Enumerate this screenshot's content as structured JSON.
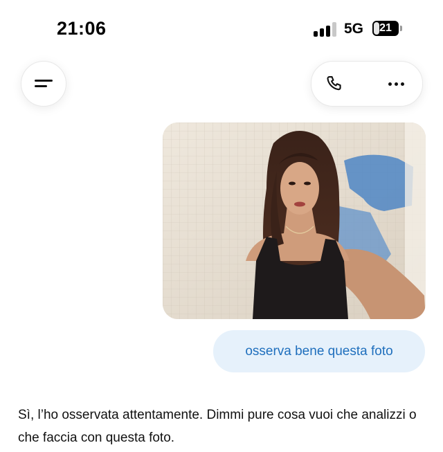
{
  "status_bar": {
    "time": "21:06",
    "network": "5G",
    "battery_level": "21",
    "signal_bars_active": 3,
    "signal_bars_total": 4
  },
  "top_bar": {
    "menu_icon": "menu-icon",
    "call_icon": "phone-icon",
    "more_icon": "more-dots-icon"
  },
  "chat": {
    "user_image_description": "photo attachment",
    "user_message": "osserva bene questa foto",
    "assistant_reply": "Sì, l’ho osservata attentamente. Dimmi pure cosa vuoi che analizzi o che faccia con questa foto."
  },
  "colors": {
    "user_bubble_bg": "#e6f1fb",
    "user_bubble_text": "#1f6fbd",
    "background": "#ffffff"
  }
}
